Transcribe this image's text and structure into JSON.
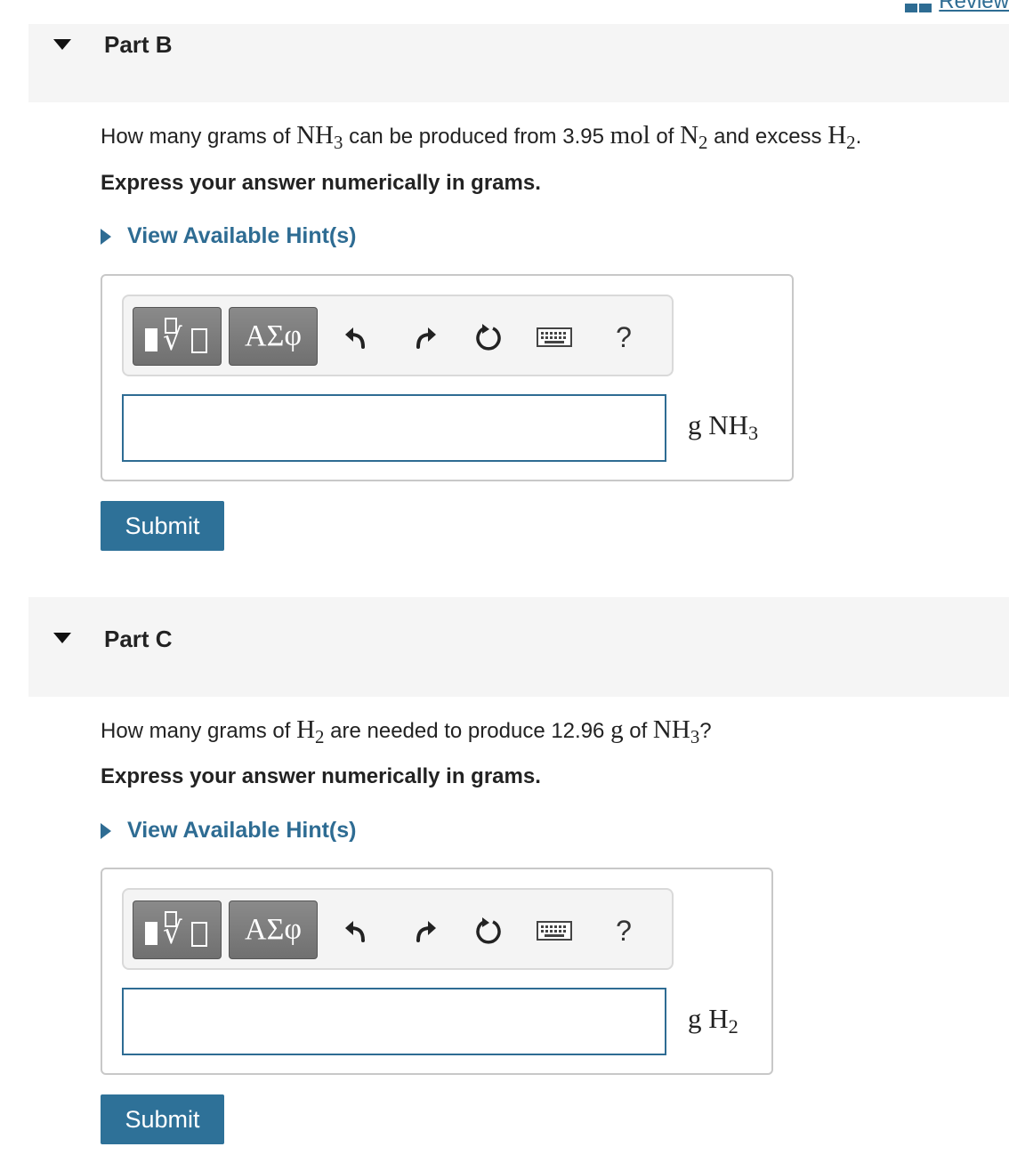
{
  "header": {
    "review_label": "Review"
  },
  "parts": [
    {
      "title": "Part B",
      "question": {
        "t1": "How many grams of ",
        "m1": "NH",
        "m1_sub": "3",
        "t2": " can be produced from 3.95 ",
        "m2": "mol",
        "t3": " of ",
        "m3": "N",
        "m3_sub": "2",
        "t4": " and excess ",
        "m4": "H",
        "m4_sub": "2",
        "t5": "."
      },
      "instruction": "Express your answer numerically in grams.",
      "hint_label": "View Available Hint(s)",
      "toolbar": {
        "greek_label": "ΑΣφ",
        "help_label": "?"
      },
      "input_value": "",
      "unit": {
        "prefix": "g NH",
        "sub": "3"
      },
      "submit_label": "Submit"
    },
    {
      "title": "Part C",
      "question": {
        "t1": "How many grams of ",
        "m1": "H",
        "m1_sub": "2",
        "t2": " are needed to produce 12.96 ",
        "m2": "g",
        "t3": " of ",
        "m3": "NH",
        "m3_sub": "3",
        "t4": "?"
      },
      "instruction": "Express your answer numerically in grams.",
      "hint_label": "View Available Hint(s)",
      "toolbar": {
        "greek_label": "ΑΣφ",
        "help_label": "?"
      },
      "input_value": "",
      "unit": {
        "prefix": "g H",
        "sub": "2"
      },
      "submit_label": "Submit"
    }
  ],
  "colors": {
    "accent": "#2e6c93",
    "header_bg": "#f5f5f5",
    "submit_bg": "#2e7198"
  }
}
